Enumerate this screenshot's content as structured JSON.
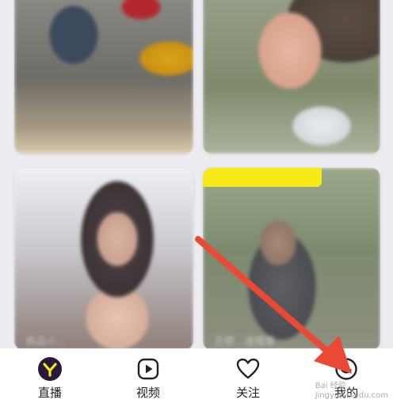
{
  "cards": [
    {
      "caption": ""
    },
    {
      "caption": ""
    },
    {
      "caption": "商品小..."
    },
    {
      "caption": "丑壁...道擂客"
    }
  ],
  "tabs": [
    {
      "label": "直播",
      "icon": "live-y-icon"
    },
    {
      "label": "视频",
      "icon": "play-icon"
    },
    {
      "label": "关注",
      "icon": "heart-icon"
    },
    {
      "label": "我的",
      "icon": "profile-face-icon"
    }
  ],
  "colors": {
    "accent": "#f7ea18",
    "live_icon_bg": "#2a1a3a",
    "arrow": "#ea4a35",
    "tab_bg": "#ffffff"
  },
  "watermark": {
    "line1": "Bai 经验",
    "line2": "jingyan.baidu.com"
  }
}
